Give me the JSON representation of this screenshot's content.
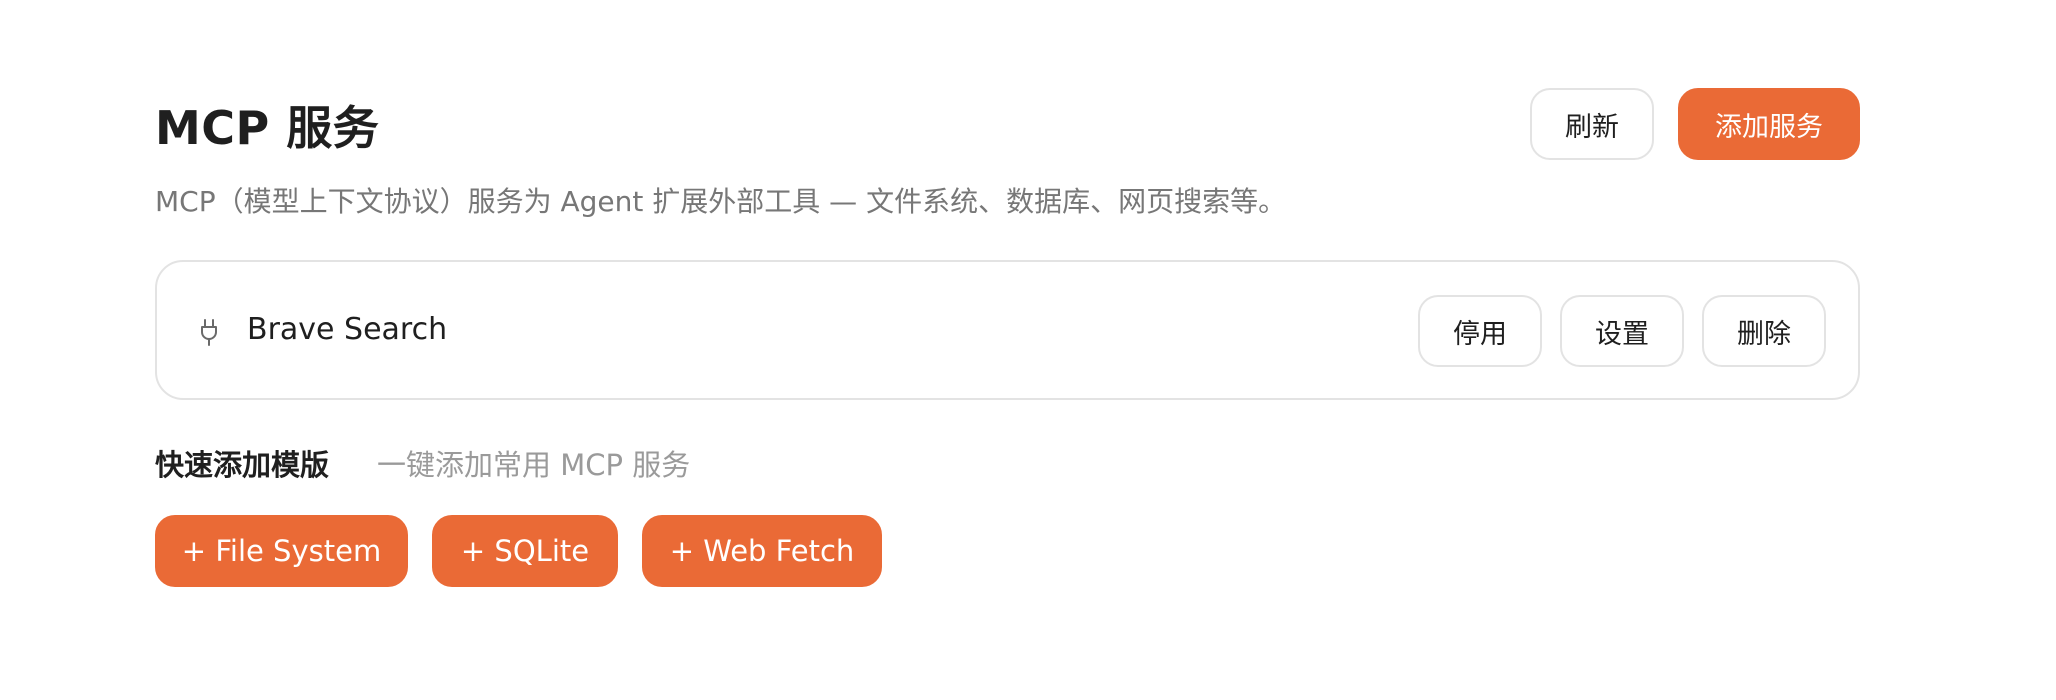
{
  "header": {
    "title": "MCP 服务",
    "description": "MCP（模型上下文协议）服务为 Agent 扩展外部工具 — 文件系统、数据库、网页搜索等。",
    "refresh_label": "刷新",
    "add_label": "添加服务"
  },
  "services": [
    {
      "icon": "plug-icon",
      "name": "Brave Search",
      "disable_label": "停用",
      "settings_label": "设置",
      "delete_label": "删除"
    }
  ],
  "templates": {
    "title": "快速添加模版",
    "subtitle": "一键添加常用 MCP 服务",
    "items": [
      {
        "label": "+ File System"
      },
      {
        "label": "+ SQLite"
      },
      {
        "label": "+ Web Fetch"
      }
    ]
  },
  "colors": {
    "accent": "#ea6a36",
    "border": "#e3e3e3",
    "muted_text": "#777777"
  }
}
